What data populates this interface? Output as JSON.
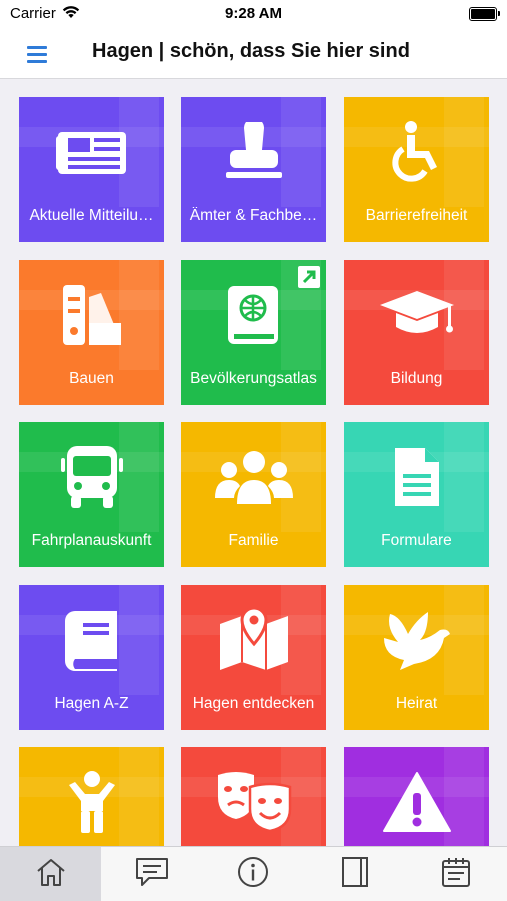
{
  "status_bar": {
    "carrier": "Carrier",
    "time": "9:28 AM"
  },
  "nav": {
    "title": "Hagen | schön, dass Sie hier sind",
    "menu_icon": "hamburger-menu-icon"
  },
  "tiles": [
    {
      "label": "Aktuelle Mitteilu…",
      "icon": "newspaper-icon",
      "color": "#6d4cf0"
    },
    {
      "label": "Ämter & Fachbe…",
      "icon": "stamp-icon",
      "color": "#6d4cf0"
    },
    {
      "label": "Barrierefreiheit",
      "icon": "wheelchair-icon",
      "color": "#f5b800"
    },
    {
      "label": "Bauen",
      "icon": "swatch-icon",
      "color": "#fb7a2c"
    },
    {
      "label": "Bevölkerungsatlas",
      "icon": "atlas-book-icon",
      "color": "#20bc4c",
      "external": true
    },
    {
      "label": "Bildung",
      "icon": "graduation-cap-icon",
      "color": "#f44a3d"
    },
    {
      "label": "Fahrplanauskunft",
      "icon": "bus-icon",
      "color": "#20bc4c"
    },
    {
      "label": "Familie",
      "icon": "family-icon",
      "color": "#f5b800"
    },
    {
      "label": "Formulare",
      "icon": "document-icon",
      "color": "#37d6b4"
    },
    {
      "label": "Hagen A-Z",
      "icon": "book-icon",
      "color": "#6d4cf0"
    },
    {
      "label": "Hagen entdecken",
      "icon": "map-pin-icon",
      "color": "#f44a3d"
    },
    {
      "label": "Heirat",
      "icon": "dove-icon",
      "color": "#f5b800"
    },
    {
      "label": "",
      "icon": "child-icon",
      "color": "#f5b800"
    },
    {
      "label": "",
      "icon": "theater-masks-icon",
      "color": "#f44a3d"
    },
    {
      "label": "",
      "icon": "warning-icon",
      "color": "#a02ee0"
    }
  ],
  "tab_bar": {
    "items": [
      {
        "icon": "home-icon",
        "active": true
      },
      {
        "icon": "message-icon",
        "active": false
      },
      {
        "icon": "info-icon",
        "active": false
      },
      {
        "icon": "notebook-icon",
        "active": false
      },
      {
        "icon": "calendar-icon",
        "active": false
      }
    ]
  }
}
